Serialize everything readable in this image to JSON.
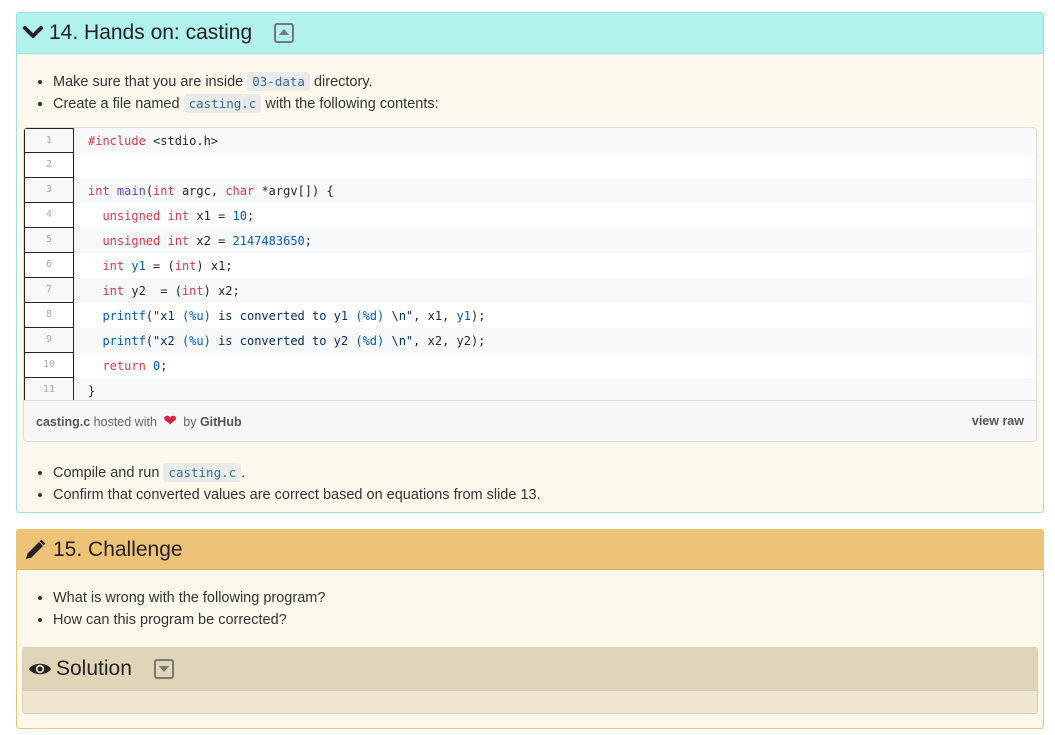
{
  "section14": {
    "title": "14. Hands on: casting",
    "bullets_top": [
      {
        "before": "Make sure that you are inside ",
        "code": "03-data",
        "after": " directory."
      },
      {
        "before": "Create a file named ",
        "code": "casting.c",
        "after": " with the following contents:"
      }
    ],
    "gist": {
      "lines": [
        [
          {
            "t": "k",
            "v": "#include "
          },
          {
            "t": "c",
            "v": "<stdio.h>"
          }
        ],
        [],
        [
          {
            "t": "k",
            "v": "int "
          },
          {
            "t": "f",
            "v": "main"
          },
          {
            "t": "c",
            "v": "("
          },
          {
            "t": "k",
            "v": "int"
          },
          {
            "t": "c",
            "v": " argc, "
          },
          {
            "t": "k",
            "v": "char"
          },
          {
            "t": "c",
            "v": " *argv[]) {"
          }
        ],
        [
          {
            "t": "c",
            "v": "  "
          },
          {
            "t": "k",
            "v": "unsigned int"
          },
          {
            "t": "c",
            "v": " x1 = "
          },
          {
            "t": "n",
            "v": "10"
          },
          {
            "t": "c",
            "v": ";"
          }
        ],
        [
          {
            "t": "c",
            "v": "  "
          },
          {
            "t": "k",
            "v": "unsigned int"
          },
          {
            "t": "c",
            "v": " x2 = "
          },
          {
            "t": "n",
            "v": "2147483650"
          },
          {
            "t": "c",
            "v": ";"
          }
        ],
        [
          {
            "t": "c",
            "v": "  "
          },
          {
            "t": "k",
            "v": "int"
          },
          {
            "t": "c",
            "v": " "
          },
          {
            "t": "n",
            "v": "y1"
          },
          {
            "t": "c",
            "v": " = ("
          },
          {
            "t": "k",
            "v": "int"
          },
          {
            "t": "c",
            "v": ") x1;"
          }
        ],
        [
          {
            "t": "c",
            "v": "  "
          },
          {
            "t": "k",
            "v": "int"
          },
          {
            "t": "c",
            "v": " y2  = ("
          },
          {
            "t": "k",
            "v": "int"
          },
          {
            "t": "c",
            "v": ") x2;"
          }
        ],
        [
          {
            "t": "c",
            "v": "  "
          },
          {
            "t": "n",
            "v": "printf"
          },
          {
            "t": "s",
            "v": "(\"x1 "
          },
          {
            "t": "n",
            "v": "(%u)"
          },
          {
            "t": "s",
            "v": " is converted to y1 "
          },
          {
            "t": "n",
            "v": "(%d)"
          },
          {
            "t": "s",
            "v": " \\n\""
          },
          {
            "t": "c",
            "v": ", x1, "
          },
          {
            "t": "n",
            "v": "y1"
          },
          {
            "t": "c",
            "v": ");"
          }
        ],
        [
          {
            "t": "c",
            "v": "  "
          },
          {
            "t": "n",
            "v": "printf"
          },
          {
            "t": "s",
            "v": "(\"x2 "
          },
          {
            "t": "n",
            "v": "(%u)"
          },
          {
            "t": "s",
            "v": " is converted to y2 "
          },
          {
            "t": "n",
            "v": "(%d)"
          },
          {
            "t": "s",
            "v": " \\n\""
          },
          {
            "t": "c",
            "v": ", x2, y2);"
          }
        ],
        [
          {
            "t": "c",
            "v": "  "
          },
          {
            "t": "k",
            "v": "return"
          },
          {
            "t": "c",
            "v": " "
          },
          {
            "t": "n",
            "v": "0"
          },
          {
            "t": "c",
            "v": ";"
          }
        ],
        [
          {
            "t": "c",
            "v": "}"
          }
        ]
      ],
      "meta": {
        "filename": "casting.c",
        "hosted_with": " hosted with ",
        "by": " by ",
        "github": "GitHub",
        "view_raw": "view raw"
      }
    },
    "bullets_bottom": [
      {
        "before": "Compile and run ",
        "code": "casting.c",
        "after": "."
      },
      {
        "before": "Confirm that converted values are correct based on equations from slide 13.",
        "code": "",
        "after": ""
      }
    ]
  },
  "section15": {
    "title": "15. Challenge",
    "bullets": [
      "What is wrong with the following program?",
      "How can this program be corrected?"
    ],
    "solution_title": "Solution"
  },
  "colors": {
    "header14": "#b1f2ec",
    "header15": "#eec377",
    "solution_header": "#e0d5b7",
    "keyword": "#d73a49",
    "number": "#005cc5"
  }
}
